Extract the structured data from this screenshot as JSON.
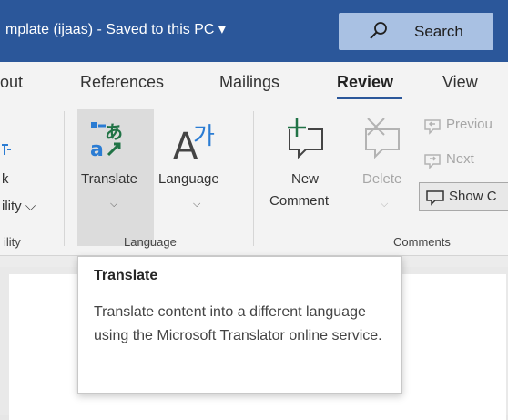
{
  "titlebar": {
    "document_title": "mplate (ijaas)  -  Saved to this PC  ▾",
    "search_label": "Search",
    "search_icon": "search-icon"
  },
  "tabs": [
    {
      "label": "out",
      "active": false
    },
    {
      "label": "References",
      "active": false
    },
    {
      "label": "Mailings",
      "active": false
    },
    {
      "label": "Review",
      "active": true
    },
    {
      "label": "View",
      "active": false
    }
  ],
  "ribbon": {
    "partial_group": {
      "line1": "k",
      "line2": "ility ⌵",
      "label": "ility"
    },
    "language_group": {
      "label": "Language",
      "translate": {
        "label": "Translate",
        "chevron": "⌵",
        "icon": "translate-icon"
      },
      "language": {
        "label": "Language",
        "chevron": "⌵",
        "icon": "language-icon"
      }
    },
    "comments_group": {
      "label": "Comments",
      "new_comment": {
        "line1": "New",
        "line2": "Comment",
        "icon": "new-comment-icon"
      },
      "delete": {
        "label": "Delete",
        "chevron": "⌵",
        "icon": "delete-comment-icon"
      },
      "previous": {
        "label": "Previou",
        "icon": "previous-comment-icon"
      },
      "next": {
        "label": "Next",
        "icon": "next-comment-icon"
      },
      "show_comments": {
        "label": "Show C",
        "icon": "show-comments-icon"
      }
    }
  },
  "tooltip": {
    "title": "Translate",
    "body": "Translate content into a different language using the Microsoft Translator online service."
  },
  "colors": {
    "titlebar": "#2b579a",
    "search_box": "#a9c1e3",
    "ribbon_bg": "#f3f3f3",
    "accent_green": "#217346"
  }
}
